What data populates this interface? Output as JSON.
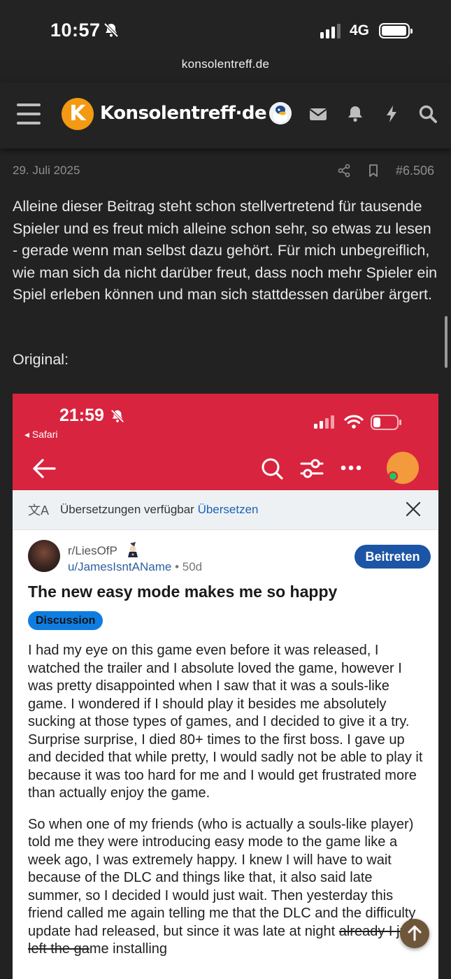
{
  "status_bar": {
    "time": "10:57",
    "network": "4G",
    "signal_bars": 3,
    "battery_level": "full"
  },
  "browser": {
    "url": "konsolentreff.de"
  },
  "site": {
    "logo_letter": "K",
    "name": "Konsolentreff·de",
    "icons": [
      "menu-icon",
      "avatar",
      "mail-icon",
      "bell-icon",
      "bolt-icon",
      "search-icon"
    ]
  },
  "post": {
    "date": "29. Juli 2025",
    "number": "#6.506",
    "body": "Alleine dieser Beitrag steht schon stellvertretend für tausende Spieler und es freut mich alleine schon sehr, so etwas zu lesen - gerade wenn man selbst dazu gehört. Für mich unbegreiflich, wie man sich da nicht darüber freut, dass noch mehr Spieler ein Spiel erleben können und man sich stattdessen darüber ärgert.",
    "original_label": "Original:"
  },
  "embed": {
    "time": "21:59",
    "back_app": "◂ Safari",
    "translation_bar": {
      "text": "Übersetzungen verfügbar",
      "link": "Übersetzen"
    },
    "subreddit": "r/LiesOfP",
    "user": "u/JamesIsntAName",
    "age": "50d",
    "join_label": "Beitreten",
    "title": "The new easy mode makes me so happy",
    "flair": "Discussion",
    "paragraph1": "I had my eye on this game even before it was released, I watched the trailer and I absolute loved the game, however I was pretty disappointed when I saw that it was a souls-like game. I wondered if I should play it besides me absolutely sucking at those types of games, and I decided to give it a try. Surprise surprise, I died 80+ times to the first boss. I gave up and decided that while pretty, I would sadly not be able to play it because it was too hard for me and I would get frustrated more than actually enjoy the game.",
    "paragraph2_a": "So when one of my friends (who is actually a souls-like player) told me they were introducing easy mode to the game like a week ago, I was extremely happy. I knew I will have to wait because of the DLC and things like that, it also said late summer, so I decided I would just wait. Then yesterday this friend called me again telling me that the DLC and the difficulty update had released, but since it was late at night ",
    "paragraph2_strike": "already I just left the ga",
    "paragraph2_b": "me installing"
  }
}
